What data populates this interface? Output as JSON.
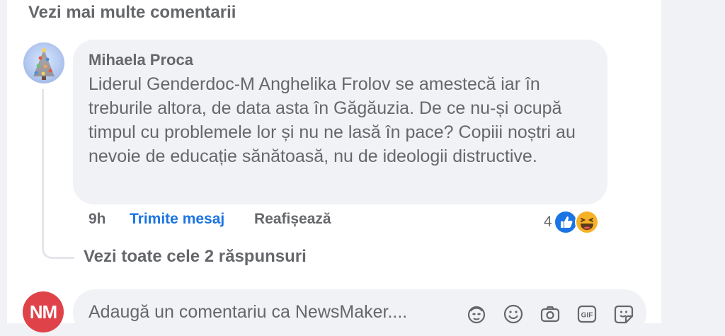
{
  "thread": {
    "more_comments_label": "Vezi mai multe comentarii",
    "comment": {
      "author": "Mihaela Proca",
      "text": "Liderul Genderdoc-M Anghelika Frolov se amestecă iar în treburile altora, de data asta în Găgăuzia. De ce nu-și ocupă timpul cu problemele lor și nu ne lasă în pace? Copiii noștri au nevoie de educație sănătoasă, nu de ideologii distructive.",
      "time": "9h",
      "send_message_label": "Trimite mesaj",
      "reshow_label": "Reafișează",
      "reaction_count": "4",
      "reaction_icons": [
        "like-icon",
        "haha-icon"
      ]
    },
    "view_replies_label": "Vezi toate cele 2 răspunsuri"
  },
  "composer": {
    "avatar_initials": "NM",
    "placeholder": "Adaugă un comentariu ca NewsMaker....",
    "icons": [
      "avatar-sticker-icon",
      "emoji-icon",
      "camera-icon",
      "gif-icon",
      "sticker-icon"
    ]
  },
  "colors": {
    "link_blue": "#1b74e4",
    "secondary_text": "#65676b",
    "bubble_bg": "#f0f2f5",
    "avatar_red": "#e0424a"
  }
}
